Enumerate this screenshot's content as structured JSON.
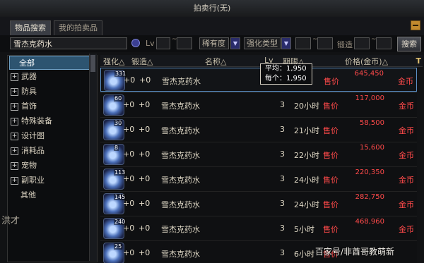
{
  "window": {
    "title": "拍卖行(无)"
  },
  "tabs": [
    {
      "label": "物品搜索"
    },
    {
      "label": "我的拍卖品"
    }
  ],
  "search": {
    "value": "雪杰克药水",
    "lv_label": "Lv",
    "tilde1": "~",
    "rarity_label": "稀有度",
    "strength_type_label": "强化类型",
    "tilde2": "~",
    "forge_label": "锻造",
    "tilde3": "~",
    "button_label": "搜索"
  },
  "sidebar": {
    "items": [
      {
        "label": "全部",
        "expandable": false,
        "selected": true
      },
      {
        "label": "武器",
        "expandable": true
      },
      {
        "label": "防具",
        "expandable": true
      },
      {
        "label": "首饰",
        "expandable": true
      },
      {
        "label": "特殊装备",
        "expandable": true
      },
      {
        "label": "设计图",
        "expandable": true
      },
      {
        "label": "消耗品",
        "expandable": true
      },
      {
        "label": "宠物",
        "expandable": true
      },
      {
        "label": "副职业",
        "expandable": true
      },
      {
        "label": "其他",
        "expandable": false
      }
    ]
  },
  "table": {
    "headers": {
      "strength": "强化△",
      "forge": "锻造△",
      "name": "名称△",
      "lv": "Lv",
      "time": "期限△",
      "price": "价格(金币)△"
    },
    "rows": [
      {
        "qty": "331",
        "strength": "+0",
        "forge": "+0",
        "name": "雪杰克药水",
        "lv": "",
        "time": "",
        "price_label": "售价",
        "total": "645,450",
        "coin": "金币"
      },
      {
        "qty": "60",
        "strength": "+0",
        "forge": "+0",
        "name": "雪杰克药水",
        "lv": "3",
        "time": "20小时",
        "price_label": "售价",
        "total": "117,000",
        "coin": "金币"
      },
      {
        "qty": "30",
        "strength": "+0",
        "forge": "+0",
        "name": "雪杰克药水",
        "lv": "3",
        "time": "21小时",
        "price_label": "售价",
        "total": "58,500",
        "coin": "金币"
      },
      {
        "qty": "8",
        "strength": "+0",
        "forge": "+0",
        "name": "雪杰克药水",
        "lv": "3",
        "time": "22小时",
        "price_label": "售价",
        "total": "15,600",
        "coin": "金币"
      },
      {
        "qty": "113",
        "strength": "+0",
        "forge": "+0",
        "name": "雪杰克药水",
        "lv": "3",
        "time": "24小时",
        "price_label": "售价",
        "total": "220,350",
        "coin": "金币"
      },
      {
        "qty": "145",
        "strength": "+0",
        "forge": "+0",
        "name": "雪杰克药水",
        "lv": "3",
        "time": "24小时",
        "price_label": "售价",
        "total": "282,750",
        "coin": "金币"
      },
      {
        "qty": "240",
        "strength": "+0",
        "forge": "+0",
        "name": "雪杰克药水",
        "lv": "3",
        "time": "5小时",
        "price_label": "售价",
        "total": "468,960",
        "coin": "金币"
      },
      {
        "qty": "25",
        "strength": "+0",
        "forge": "+0",
        "name": "雪杰克药水",
        "lv": "3",
        "time": "6小时",
        "price_label": "售价",
        "total": "",
        "coin": ""
      }
    ]
  },
  "tooltip": {
    "avg": "平均：1,950",
    "each": "每个：1,950"
  },
  "pin_label": "T",
  "background_text": "洪才",
  "watermark": "百家号/非酋哥教萌新"
}
